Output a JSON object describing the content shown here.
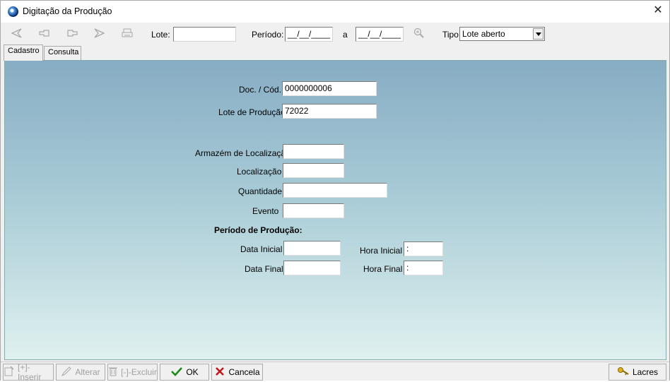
{
  "window": {
    "title": "Digitação da Produção",
    "close_glyph": "✕"
  },
  "toolbar": {
    "icons": [
      "first-icon",
      "previous-icon",
      "next-icon",
      "last-icon",
      "print-icon"
    ],
    "lote_label": "Lote:",
    "lote_value": "",
    "periodo_label": "Período:",
    "periodo_inicio": "__/__/____",
    "periodo_sep": "a",
    "periodo_fim": "__/__/____",
    "search_icon": "magnifier-icon",
    "tipo_label": "Tipo",
    "tipo_value": "Lote aberto"
  },
  "tabs": [
    {
      "label": "Cadastro",
      "active": true
    },
    {
      "label": "Consulta",
      "active": false
    }
  ],
  "form": {
    "doc_label": "Doc. / Cód.",
    "doc_value": "0000000006",
    "lote_label": "Lote de Produção",
    "lote_value": "72022",
    "armazem_label": "Armazém de Localização",
    "armazem_value": "",
    "localizacao_label": "Localização",
    "localizacao_value": "",
    "quantidade_label": "Quantidade",
    "quantidade_value": "",
    "evento_label": "Evento",
    "evento_value": "",
    "periodo_title": "Período de Produção:",
    "data_inicial_label": "Data Inicial",
    "data_inicial_value": "",
    "hora_inicial_label": "Hora Inicial",
    "hora_inicial_value": ":",
    "data_final_label": "Data Final",
    "data_final_value": "",
    "hora_final_label": "Hora Final",
    "hora_final_value": ":"
  },
  "bottom": {
    "inserir": "[+]-Inserir",
    "alterar": "Alterar",
    "excluir": "[-]-Excluir",
    "ok": "OK",
    "cancela": "Cancela",
    "lacres": "Lacres"
  },
  "colors": {
    "ok": "#1a8a1a",
    "cancel": "#c0171d",
    "panel_top": "#87adc4",
    "panel_bottom": "#dff1ef"
  }
}
